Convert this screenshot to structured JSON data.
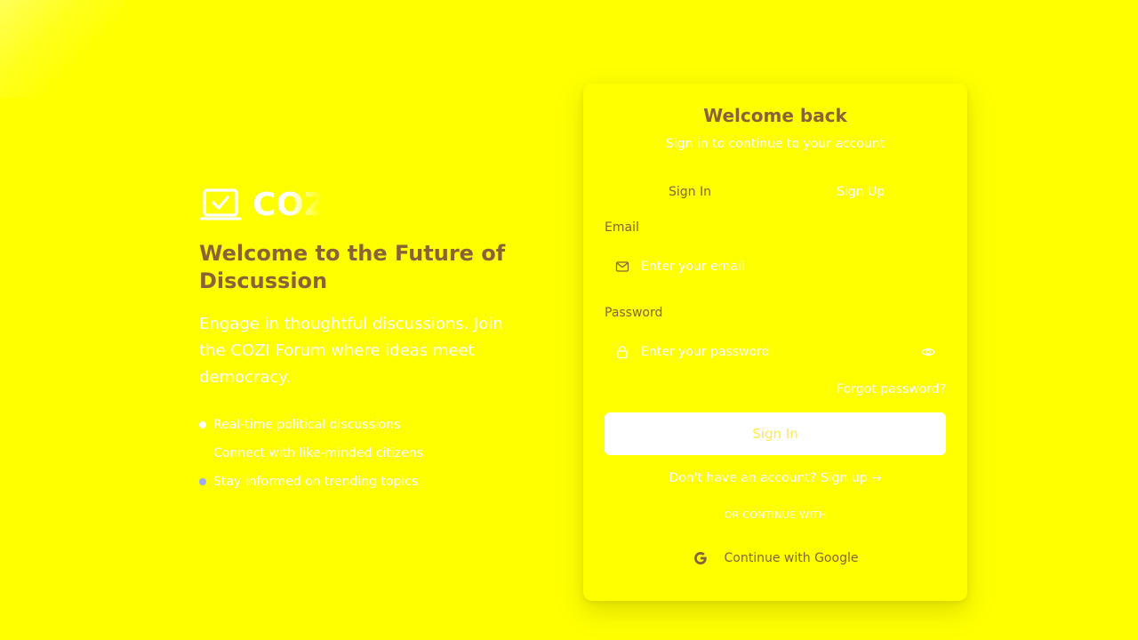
{
  "colors": {
    "background": "#ffff00",
    "accent_text": "#8a6236",
    "white": "#ffffff",
    "bullet_1": "#ffffff",
    "bullet_2": "#ffff00",
    "bullet_3": "#9fa8ff"
  },
  "brand": {
    "name": "COZI",
    "icon": "checkbox-laptop-icon"
  },
  "hero": {
    "title": "Welcome to the Future of Discussion",
    "description": "Engage in thoughtful discussions. Join the COZI Forum where ideas meet democracy."
  },
  "features": [
    {
      "text": "Real-time political discussions"
    },
    {
      "text": "Connect with like-minded citizens"
    },
    {
      "text": "Stay informed on trending topics"
    }
  ],
  "card": {
    "title": "Welcome back",
    "subtitle": "Sign in to continue to your account",
    "tabs": [
      {
        "label": "Sign In",
        "active": true
      },
      {
        "label": "Sign Up",
        "active": false
      }
    ],
    "email": {
      "label": "Email",
      "placeholder": "Enter your email",
      "icon": "mail-icon"
    },
    "password": {
      "label": "Password",
      "placeholder": "Enter your password",
      "icon": "lock-icon",
      "toggle_icon": "eye-icon"
    },
    "forgot": "Forgot password?",
    "submit": "Sign In",
    "signup_prompt": "Don't have an account?",
    "signup_link": "Sign up →",
    "divider": "OR CONTINUE WITH",
    "google": {
      "label": "Continue with Google",
      "icon": "google-icon"
    }
  }
}
